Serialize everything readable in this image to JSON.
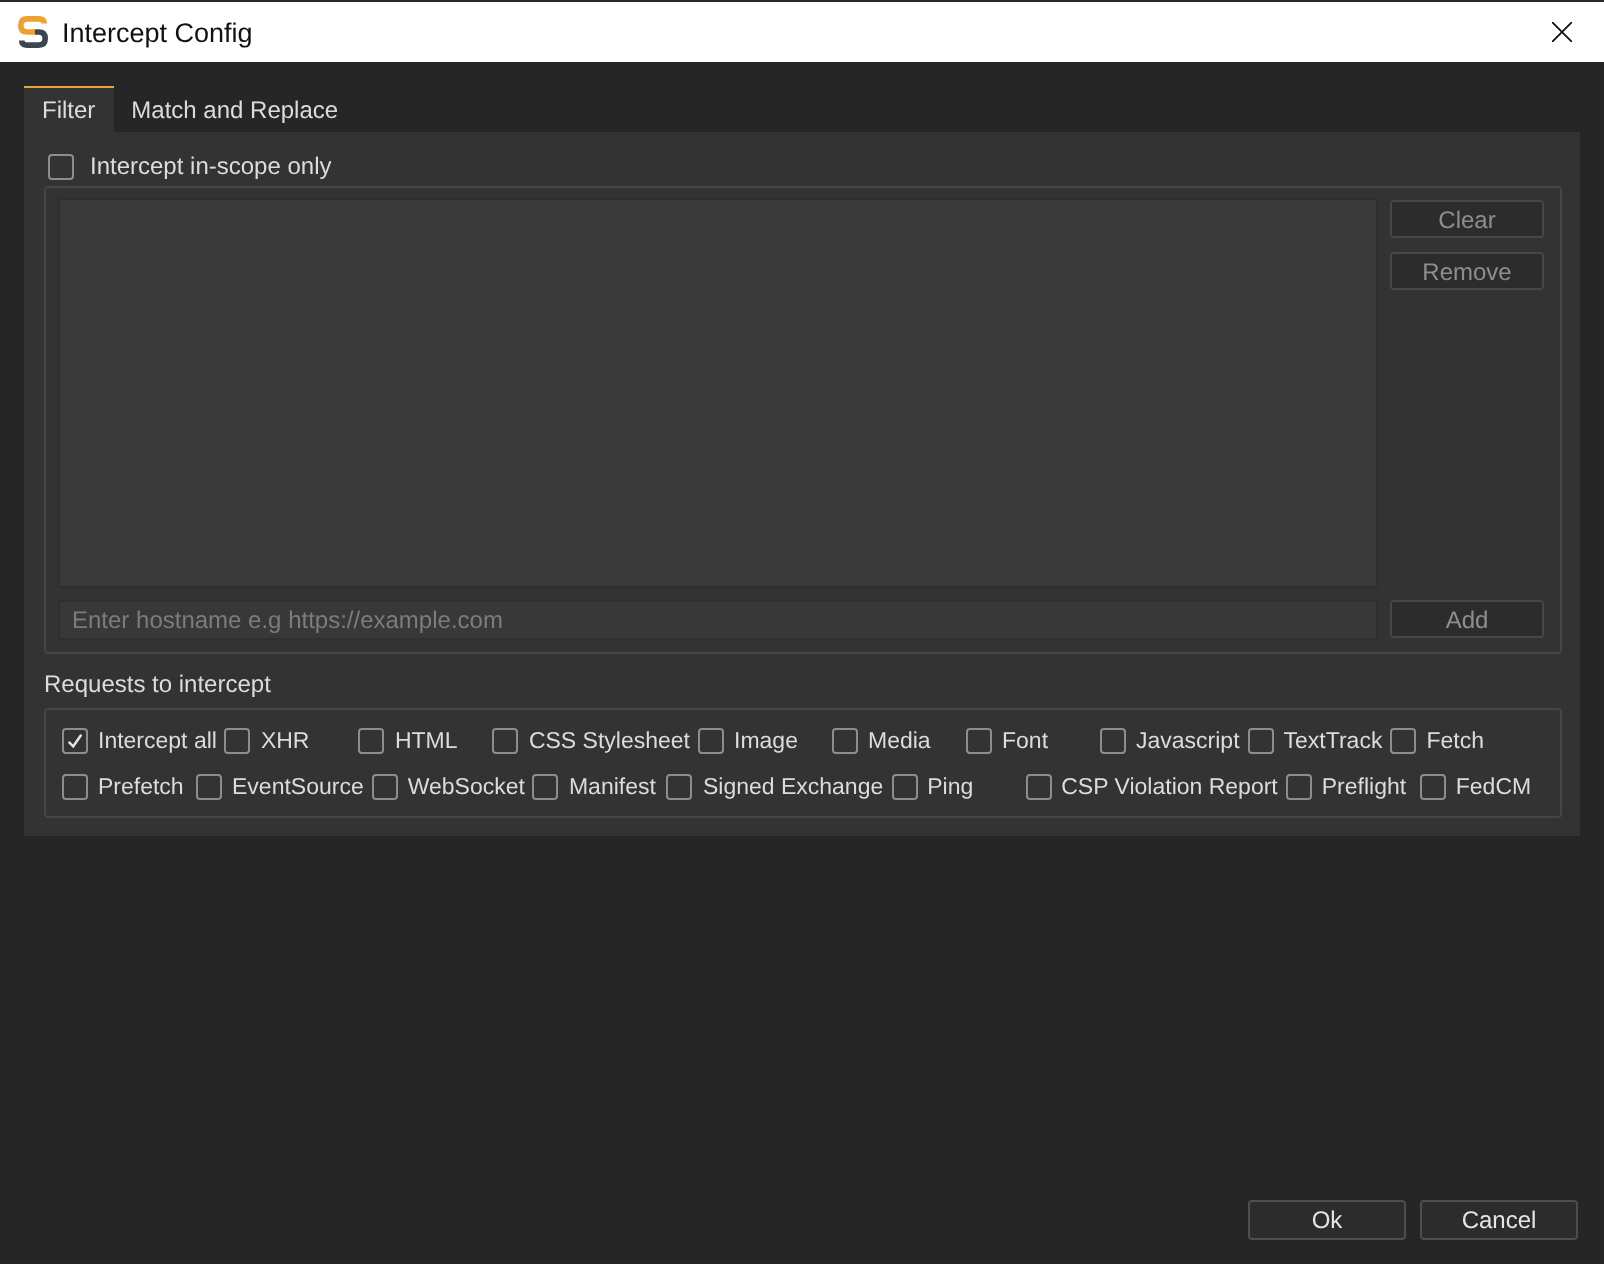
{
  "window": {
    "title": "Intercept Config"
  },
  "tabs": [
    {
      "label": "Filter",
      "selected": true
    },
    {
      "label": "Match and Replace",
      "selected": false
    }
  ],
  "filter": {
    "scope_only": {
      "label": "Intercept in-scope only",
      "checked": false
    },
    "host_list_buttons": [
      {
        "label": "Clear",
        "disabled": true
      },
      {
        "label": "Remove",
        "disabled": true
      }
    ],
    "hostname_field": {
      "placeholder": "Enter hostname e.g https://example.com"
    },
    "add_button": {
      "label": "Add",
      "disabled": true
    },
    "requests": {
      "title": "Requests to intercept",
      "types": [
        {
          "label": "Intercept all",
          "checked": true
        },
        {
          "label": "XHR",
          "checked": false
        },
        {
          "label": "HTML",
          "checked": false
        },
        {
          "label": "CSS Stylesheet",
          "checked": false
        },
        {
          "label": "Image",
          "checked": false
        },
        {
          "label": "Media",
          "checked": false
        },
        {
          "label": "Font",
          "checked": false
        },
        {
          "label": "Javascript",
          "checked": false
        },
        {
          "label": "TextTrack",
          "checked": false
        },
        {
          "label": "Fetch",
          "checked": false
        },
        {
          "label": "Prefetch",
          "checked": false
        },
        {
          "label": "EventSource",
          "checked": false
        },
        {
          "label": "WebSocket",
          "checked": false
        },
        {
          "label": "Manifest",
          "checked": false
        },
        {
          "label": "Signed Exchange",
          "checked": false
        },
        {
          "label": "Ping",
          "checked": false
        },
        {
          "label": "CSP Violation Report",
          "checked": false
        },
        {
          "label": "Preflight",
          "checked": false
        },
        {
          "label": "FedCM",
          "checked": false
        }
      ]
    }
  },
  "buttons": [
    {
      "label": "Ok"
    },
    {
      "label": "Cancel"
    }
  ]
}
